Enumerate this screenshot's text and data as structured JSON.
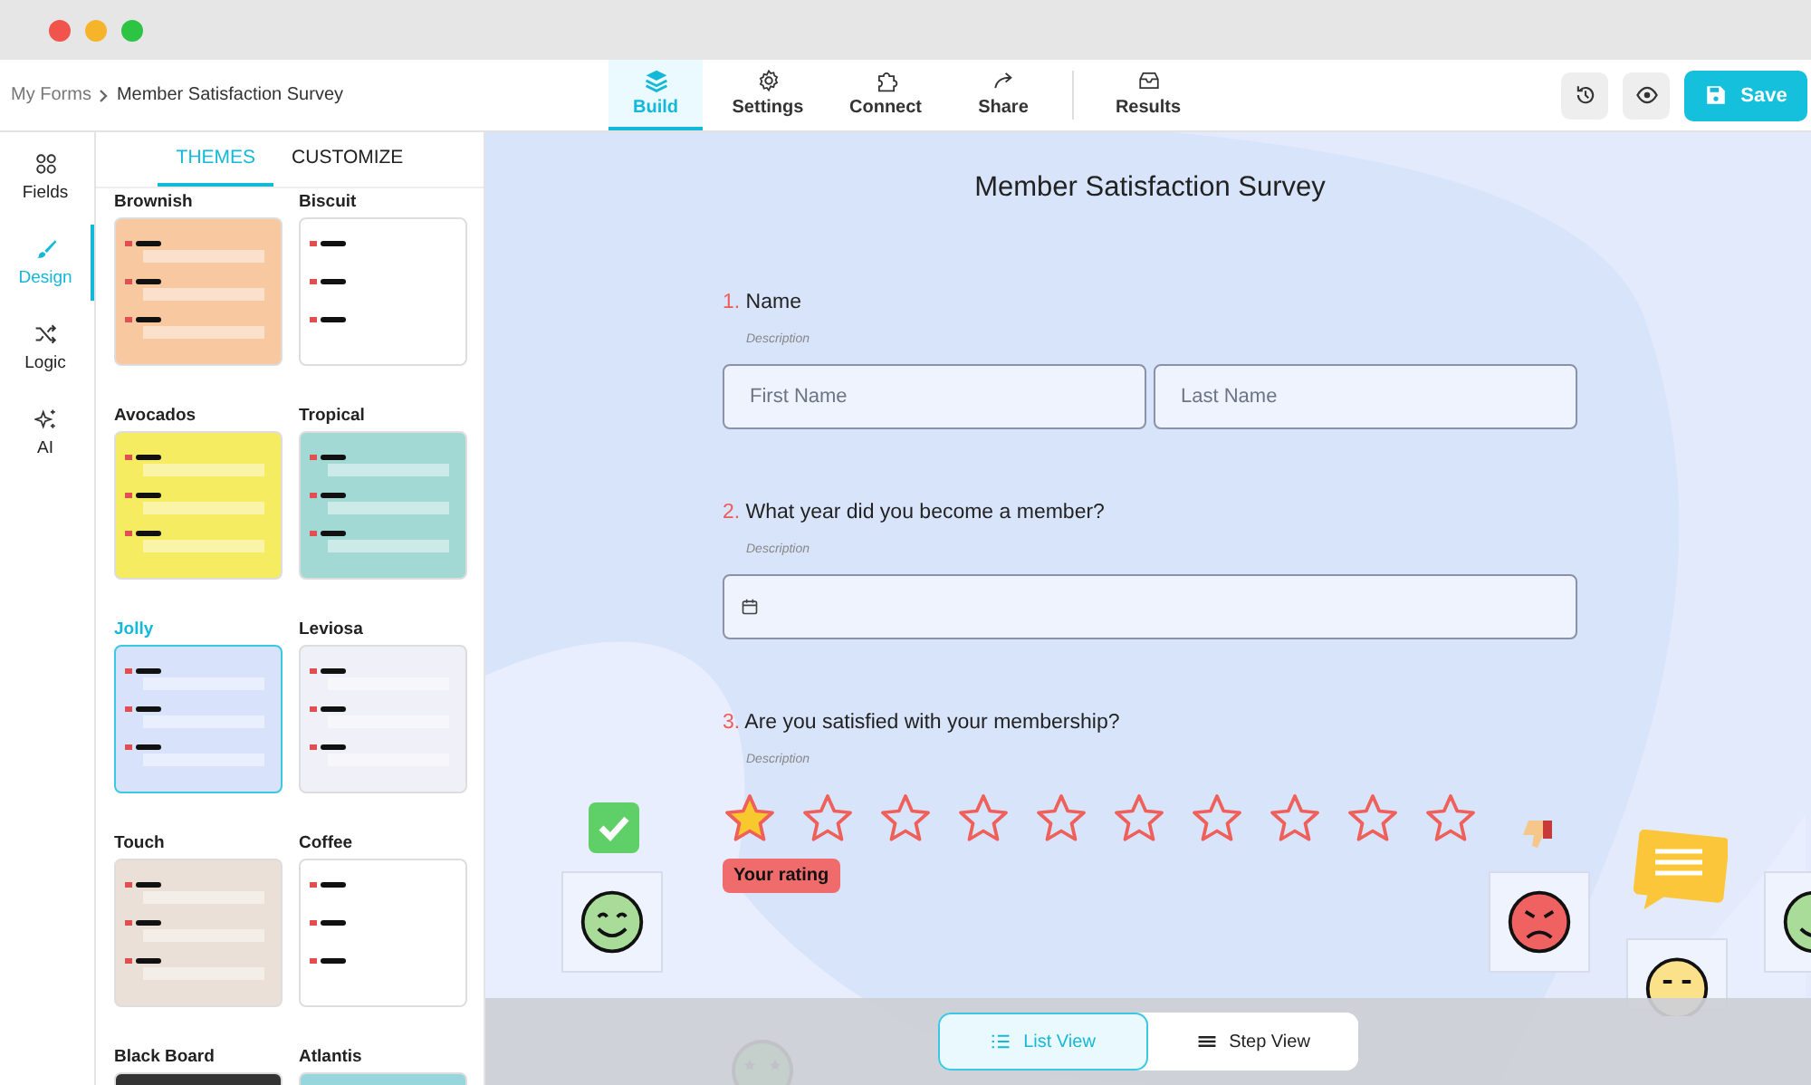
{
  "breadcrumb": {
    "parent": "My Forms",
    "current": "Member Satisfaction Survey"
  },
  "nav_tabs": [
    {
      "label": "Build",
      "selected": true
    },
    {
      "label": "Settings",
      "selected": false
    },
    {
      "label": "Connect",
      "selected": false
    },
    {
      "label": "Share",
      "selected": false
    },
    {
      "label": "Results",
      "selected": false
    }
  ],
  "save_button": "Save",
  "rail": [
    {
      "label": "Fields",
      "selected": false
    },
    {
      "label": "Design",
      "selected": true
    },
    {
      "label": "Logic",
      "selected": false
    },
    {
      "label": "AI",
      "selected": false
    }
  ],
  "panel_tabs": [
    {
      "label": "THEMES",
      "selected": true
    },
    {
      "label": "CUSTOMIZE",
      "selected": false
    }
  ],
  "themes": [
    {
      "name": "Brownish",
      "color": "#f8c8a0",
      "selected": false
    },
    {
      "name": "Biscuit",
      "color": "#ffffff",
      "selected": false
    },
    {
      "name": "Avocados",
      "color": "#f5ec62",
      "selected": false
    },
    {
      "name": "Tropical",
      "color": "#a3d9d4",
      "selected": false
    },
    {
      "name": "Jolly",
      "color": "#d8e2fa",
      "selected": true
    },
    {
      "name": "Leviosa",
      "color": "#f0f0f8",
      "selected": false
    },
    {
      "name": "Touch",
      "color": "#ebe0d8",
      "selected": false
    },
    {
      "name": "Coffee",
      "color": "#ffffff",
      "selected": false
    },
    {
      "name": "Black Board",
      "color": "#333333",
      "selected": false
    },
    {
      "name": "Atlantis",
      "color": "#98d6de",
      "selected": false
    }
  ],
  "form": {
    "title": "Member Satisfaction Survey",
    "questions": [
      {
        "number": "1.",
        "label": "Name",
        "description": "Description",
        "kind": "name",
        "fields": [
          {
            "placeholder": "First Name"
          },
          {
            "placeholder": "Last Name"
          }
        ]
      },
      {
        "number": "2.",
        "label": "What year did you become a member?",
        "description": "Description",
        "kind": "date"
      },
      {
        "number": "3.",
        "label": "Are you satisfied with your membership?",
        "description": "Description",
        "kind": "rating",
        "stars": 1,
        "tooltip": "Your rating"
      }
    ]
  },
  "view_toggle": [
    {
      "label": "List View",
      "selected": true
    },
    {
      "label": "Step View",
      "selected": false
    }
  ]
}
